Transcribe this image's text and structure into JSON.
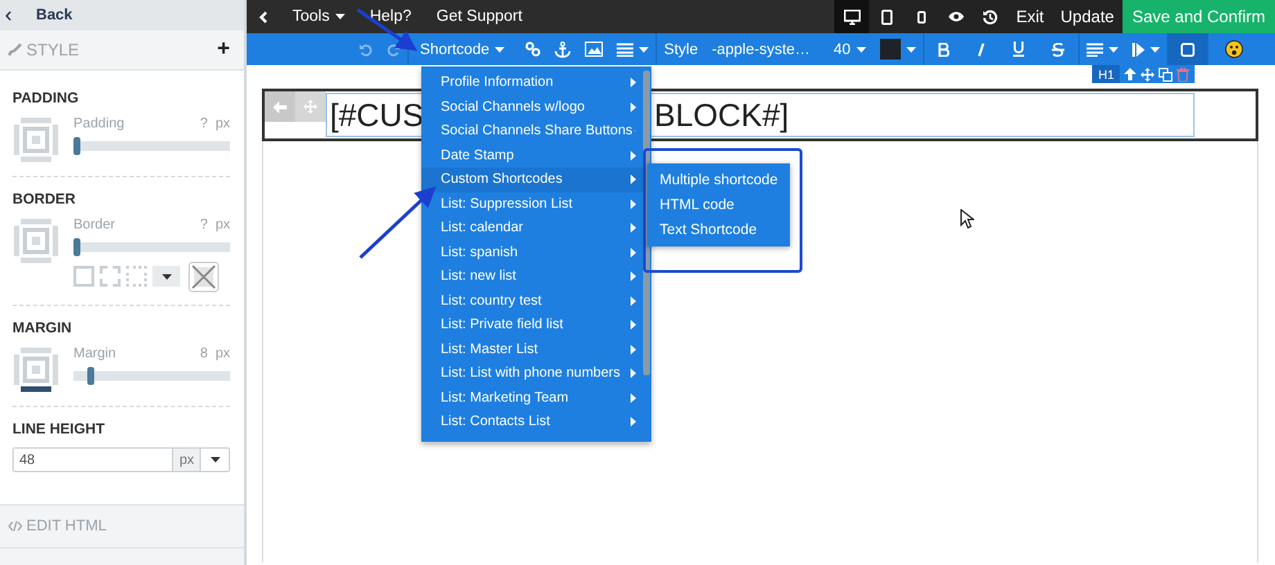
{
  "sidebar": {
    "back": "Back",
    "section": "STYLE",
    "add": "+",
    "groups": [
      {
        "kind": "slider",
        "heading": "PADDING",
        "label": "Padding",
        "value": "?",
        "unit": "px",
        "level": 0
      },
      {
        "kind": "border",
        "heading": "BORDER",
        "label": "Border",
        "value": "?",
        "unit": "px",
        "level": 0
      },
      {
        "kind": "margin",
        "heading": "MARGIN",
        "label": "Margin",
        "value": "8",
        "unit": "px",
        "level": 0.09
      },
      {
        "kind": "field",
        "heading": "LINE HEIGHT",
        "value": "48",
        "unit": "px"
      }
    ],
    "edit_html": "EDIT HTML"
  },
  "top_bar": {
    "menus": [
      {
        "label": "Tools",
        "dropdown": true
      },
      {
        "label": "Help?",
        "dropdown": false
      },
      {
        "label": "Get Support",
        "dropdown": false
      }
    ],
    "devices": [
      {
        "kind": "desktop",
        "selected": true
      },
      {
        "kind": "tablet",
        "selected": false
      },
      {
        "kind": "phone",
        "selected": false
      }
    ],
    "buttons": [
      {
        "label": "Exit",
        "kind": "plain"
      },
      {
        "label": "Update",
        "kind": "plain"
      },
      {
        "label": "Save and Confirm",
        "kind": "primary"
      }
    ]
  },
  "toolbar": {
    "shortcode": "Shortcode",
    "style_label": "Style",
    "font": "-apple-syste…",
    "size": "40",
    "tag": "H1"
  },
  "heading": {
    "visible_parts": [
      "[#CUS",
      "BLOCK#]"
    ]
  },
  "shortcode_menu": {
    "items": [
      {
        "label": "Profile Information",
        "expanded": false
      },
      {
        "label": "Social Channels w/logo",
        "expanded": false
      },
      {
        "label": "Social Channels Share Buttons",
        "expanded": false
      },
      {
        "label": "Date Stamp",
        "expanded": false
      },
      {
        "label": "Custom Shortcodes",
        "expanded": true
      },
      {
        "label": "List: Suppression List",
        "expanded": false
      },
      {
        "label": "List: calendar",
        "expanded": false
      },
      {
        "label": "List: spanish",
        "expanded": false
      },
      {
        "label": "List: new list",
        "expanded": false
      },
      {
        "label": "List: country test",
        "expanded": false
      },
      {
        "label": "List: Private field list",
        "expanded": false
      },
      {
        "label": "List: Master List",
        "expanded": false
      },
      {
        "label": "List: List with phone numbers",
        "expanded": false
      },
      {
        "label": "List: Marketing Team",
        "expanded": false
      },
      {
        "label": "List: Contacts List",
        "expanded": false
      }
    ],
    "submenu": [
      "Multiple shortcode",
      "HTML code",
      "Text Shortcode"
    ]
  }
}
